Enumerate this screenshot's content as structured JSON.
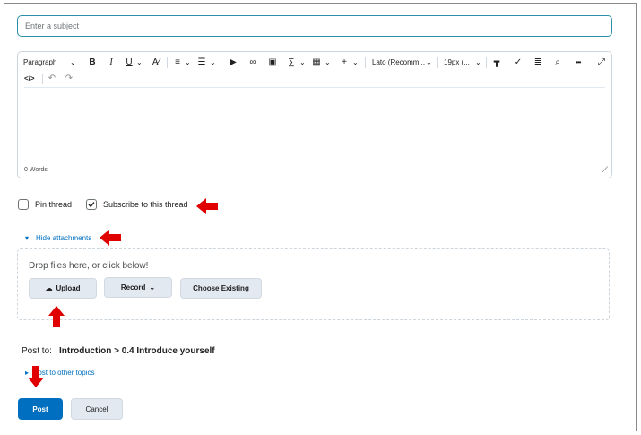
{
  "subject": {
    "placeholder": "Enter a subject"
  },
  "toolbar": {
    "paragraph": "Paragraph",
    "bold": "B",
    "italic": "I",
    "underline": "U",
    "font": "Lato (Recomm...",
    "size": "19px (...",
    "more": "•••"
  },
  "editor": {
    "word_count": "0 Words"
  },
  "options": {
    "pin_thread": "Pin thread",
    "subscribe": "Subscribe to this thread",
    "pin_checked": false,
    "subscribe_checked": true
  },
  "attachments": {
    "toggle": "Hide attachments",
    "drop_text": "Drop files here, or click below!",
    "upload": "Upload",
    "record": "Record",
    "choose_existing": "Choose Existing"
  },
  "post_to": {
    "label": "Post to:",
    "path": "Introduction > 0.4 Introduce yourself",
    "other_topics": "Post to other topics"
  },
  "actions": {
    "post": "Post",
    "cancel": "Cancel"
  },
  "colors": {
    "accent": "#006fbf",
    "annotation_arrow": "#e00000"
  }
}
